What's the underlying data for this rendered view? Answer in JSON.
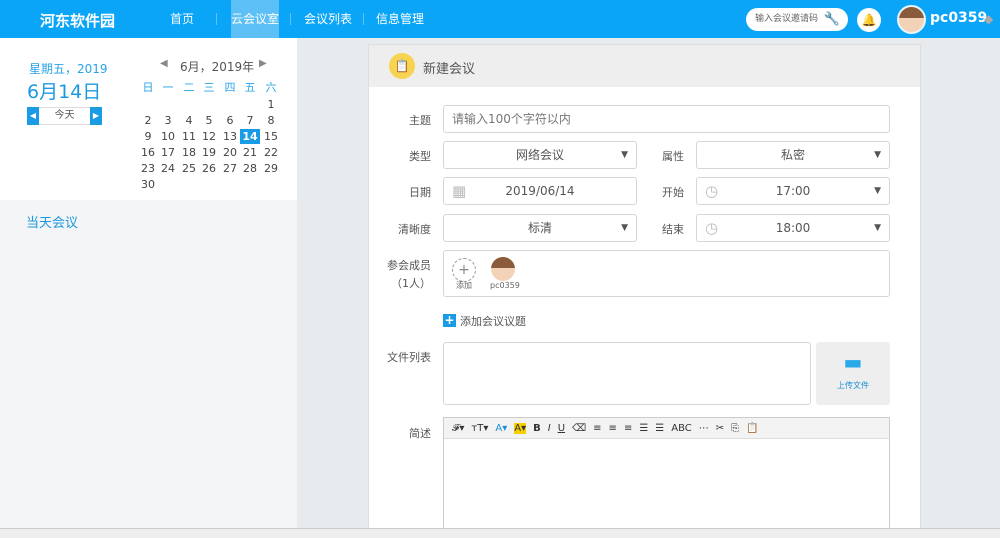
{
  "header": {
    "brand": "河东软件园",
    "nav": [
      "首页",
      "云会议室",
      "会议列表",
      "信息管理"
    ],
    "active_nav": 1,
    "invite_placeholder": "输入会议邀请码",
    "username": "pc0359"
  },
  "left": {
    "weekday_year": "星期五，2019",
    "big_date": "6月14日",
    "today_btn": "今天",
    "calendar_title": "6月，2019年",
    "weekdays": [
      "日",
      "一",
      "二",
      "三",
      "四",
      "五",
      "六"
    ],
    "weeks": [
      [
        null,
        null,
        null,
        null,
        null,
        null,
        1
      ],
      [
        2,
        3,
        4,
        5,
        6,
        7,
        8
      ],
      [
        9,
        10,
        11,
        12,
        13,
        14,
        15
      ],
      [
        16,
        17,
        18,
        19,
        20,
        21,
        22
      ],
      [
        23,
        24,
        25,
        26,
        27,
        28,
        29
      ],
      [
        30,
        null,
        null,
        null,
        null,
        null,
        null
      ]
    ],
    "selected_day": 14,
    "today_meetings": "当天会议"
  },
  "form": {
    "title": "新建会议",
    "subject_label": "主题",
    "subject_placeholder": "请输入100个字符以内",
    "type_label": "类型",
    "type_value": "网络会议",
    "attr_label": "属性",
    "attr_value": "私密",
    "date_label": "日期",
    "date_value": "2019/06/14",
    "start_label": "开始",
    "start_value": "17:00",
    "quality_label": "清晰度",
    "quality_value": "标清",
    "end_label": "结束",
    "end_value": "18:00",
    "members_label": "参会成员",
    "members_count": "（1人）",
    "add_member": "添加",
    "member_name": "pc0359",
    "add_topic": "添加会议议题",
    "files_label": "文件列表",
    "upload": "上传文件",
    "desc_label": "简述",
    "toolbar": [
      "𝓕▾",
      "тT▾",
      "A▾",
      "A▾",
      "B",
      "I",
      "U",
      "⌫",
      "≡",
      "≡",
      "≡",
      "☰",
      "☰",
      "ABC",
      "⋯",
      "✂",
      "⎘",
      "📋"
    ]
  }
}
